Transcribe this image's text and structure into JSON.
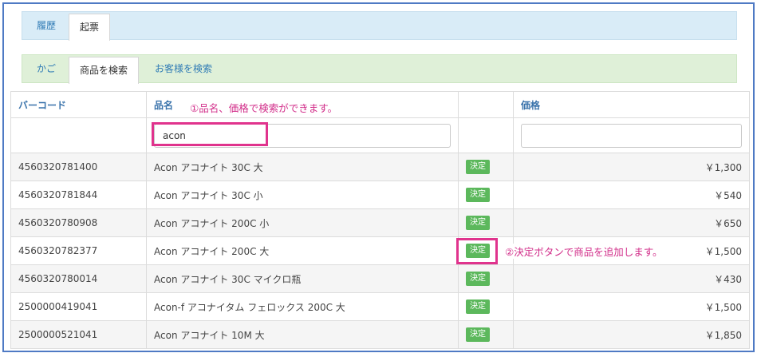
{
  "tabs_top": [
    {
      "label": "履歴",
      "active": false
    },
    {
      "label": "起票",
      "active": true
    }
  ],
  "tabs_sub": [
    {
      "label": "かご",
      "active": false
    },
    {
      "label": "商品を検索",
      "active": true
    },
    {
      "label": "お客様を検索",
      "active": false
    }
  ],
  "table": {
    "headers": {
      "barcode": "バーコード",
      "name": "品名",
      "action": "",
      "price": "価格"
    },
    "filter": {
      "name": "acon",
      "price": ""
    },
    "decide_label": "決定",
    "rows": [
      {
        "barcode": "4560320781400",
        "name": "Acon アコナイト 30C 大",
        "price": "￥1,300"
      },
      {
        "barcode": "4560320781844",
        "name": "Acon アコナイト 30C 小",
        "price": "￥540"
      },
      {
        "barcode": "4560320780908",
        "name": "Acon アコナイト 200C 小",
        "price": "￥650"
      },
      {
        "barcode": "4560320782377",
        "name": "Acon アコナイト 200C 大",
        "price": "￥1,500"
      },
      {
        "barcode": "4560320780014",
        "name": "Acon アコナイト 30C マイクロ瓶",
        "price": "￥430"
      },
      {
        "barcode": "2500000419041",
        "name": "Acon-f アコナイタム フェロックス 200C 大",
        "price": "￥1,500"
      },
      {
        "barcode": "2500000521041",
        "name": "Acon アコナイト 10M 大",
        "price": "￥1,850"
      }
    ]
  },
  "annotations": {
    "note1": "①品名、価格で検索ができます。",
    "note2": "②決定ボタンで商品を追加します。"
  },
  "colors": {
    "accent": "#e0338d",
    "button": "#5cb85c",
    "tab_link": "#2f7bb5"
  }
}
